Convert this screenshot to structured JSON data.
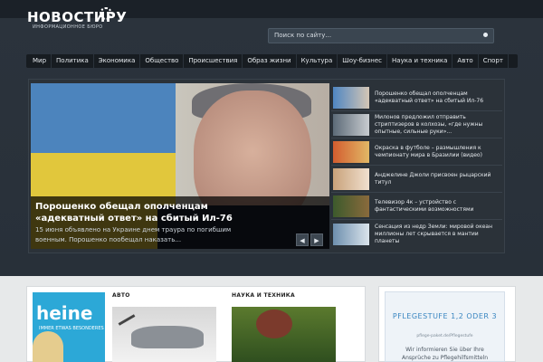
{
  "header": {
    "logo_title": "НОВОСТИРУ",
    "logo_subtitle": "ИНФОРМАЦИОННОЕ БЮРО",
    "search_placeholder": "Поиск по сайту..."
  },
  "nav": {
    "items": [
      "Мир",
      "Политика",
      "Экономика",
      "Общество",
      "Происшествия",
      "Образ жизни",
      "Культура",
      "Шоу-бизнес",
      "Наука и техника",
      "Авто",
      "Спорт"
    ]
  },
  "slider": {
    "hero_title": "Порошенко обещал ополченцам «адекватный ответ» на сбитый Ил-76",
    "hero_desc": "15 июня объявлено на Украине днем траура по погибшим военным. Порошенко пообещал наказать...",
    "prev_label": "◀",
    "next_label": "▶",
    "side_items": [
      {
        "text": "Порошенко обещал ополченцам «адекватный ответ» на сбитый Ил-76"
      },
      {
        "text": "Милонов предложил отправить стриптизеров в колхозы, «где нужны опытные, сильные руки»..."
      },
      {
        "text": "Окраска в футболе – размышления к чемпионату мира в Бразилии (видео)"
      },
      {
        "text": "Анджелине Джоли присвоен рыцарский титул"
      },
      {
        "text": "Телевизор 4к – устройство с фантастическими возможностями"
      },
      {
        "text": "Сенсация из недр Земли: мировой океан миллионы лет скрывается в мантии планеты"
      }
    ]
  },
  "content": {
    "ad_brand": "heine",
    "ad_tagline": "IMMER ETWAS BESONDERES",
    "section_auto": "АВТО",
    "section_science": "НАУКА И ТЕХНИКА",
    "pf_title": "PFLEGESTUFE 1,2 ODER 3",
    "pf_url": "pflege-paket.de/Pflegestufe",
    "pf_text": "Wir informieren Sie über Ihre Ansprüche zu Pflegehilfsmitteln"
  }
}
